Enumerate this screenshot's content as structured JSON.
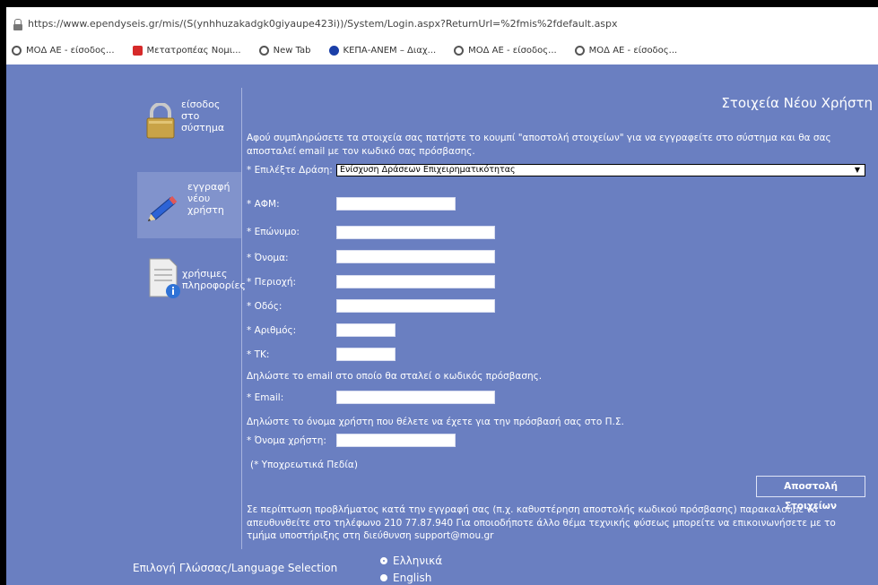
{
  "browser": {
    "url": "https://www.ependyseis.gr/mis/(S(ynhhuzakadgk0giyaupe423i))/System/Login.aspx?ReturnUrl=%2fmis%2fdefault.aspx",
    "bookmarks": [
      {
        "label": "ΜΟΔ ΑΕ - είσοδος...",
        "icon": "globe-icon"
      },
      {
        "label": "Μετατροπέας Νομι...",
        "icon": "converter-icon"
      },
      {
        "label": "New Tab",
        "icon": "globe-icon"
      },
      {
        "label": "ΚΕΠΑ-ΑΝΕΜ – Διαχ...",
        "icon": "kepa-icon"
      },
      {
        "label": "ΜΟΔ ΑΕ - είσοδος...",
        "icon": "globe-icon"
      },
      {
        "label": "ΜΟΔ ΑΕ - είσοδος...",
        "icon": "globe-icon"
      }
    ]
  },
  "sidebar": {
    "items": [
      {
        "label": "είσοδος στο σύστημα",
        "icon": "lock-icon"
      },
      {
        "label": "εγγραφή νέου χρήστη",
        "icon": "pencil-icon"
      },
      {
        "label": "χρήσιμες πληροφορίες",
        "icon": "info-document-icon"
      }
    ]
  },
  "form": {
    "title": "Στοιχεία Νέου Χρήστη",
    "intro": "Αφού συμπληρώσετε τα στοιχεία σας πατήστε το κουμπί \"αποστολή στοιχείων\" για να εγγραφείτε στο σύστημα και θα σας αποσταλεί email με τον κωδικό σας πρόσβασης.",
    "action_label": "* Επιλέξτε Δράση:",
    "action_value": "Ενίσχυση Δράσεων Επιχειρηματικότητας",
    "afm_label": "* ΑΦΜ:",
    "surname_label": "* Επώνυμο:",
    "name_label": "* Όνομα:",
    "region_label": "* Περιοχή:",
    "street_label": "* Οδός:",
    "number_label": "* Αριθμός:",
    "tk_label": "* ΤΚ:",
    "email_note": "Δηλώστε το email στο οποίο θα σταλεί ο κωδικός πρόσβασης.",
    "email_label": "* Email:",
    "username_note": "Δηλώστε το όνομα χρήστη που θέλετε να έχετε για την πρόσβασή σας στο Π.Σ.",
    "username_label": "* Όνομα χρήστη:",
    "required_note": "(* Υποχρεωτικά Πεδία)",
    "submit_label": "Αποστολή Στοιχείων",
    "footer": "Σε περίπτωση προβλήματος κατά την εγγραφή σας (π.χ. καθυστέρηση αποστολής κωδικού πρόσβασης) παρακαλούμε να απευθυνθείτε στο τηλέφωνο 210 77.87.940 Για οποιοδήποτε άλλο θέμα τεχνικής φύσεως μπορείτε να επικοινωνήσετε με το τμήμα υποστήριξης στη διεύθυνση support@mou.gr"
  },
  "language": {
    "label": "Επιλογή Γλώσσας/Language Selection",
    "options": [
      "Ελληνικά",
      "English"
    ],
    "selected": "Ελληνικά"
  },
  "colors": {
    "background": "#6a7fc1",
    "active_nav": "#8193cc"
  }
}
